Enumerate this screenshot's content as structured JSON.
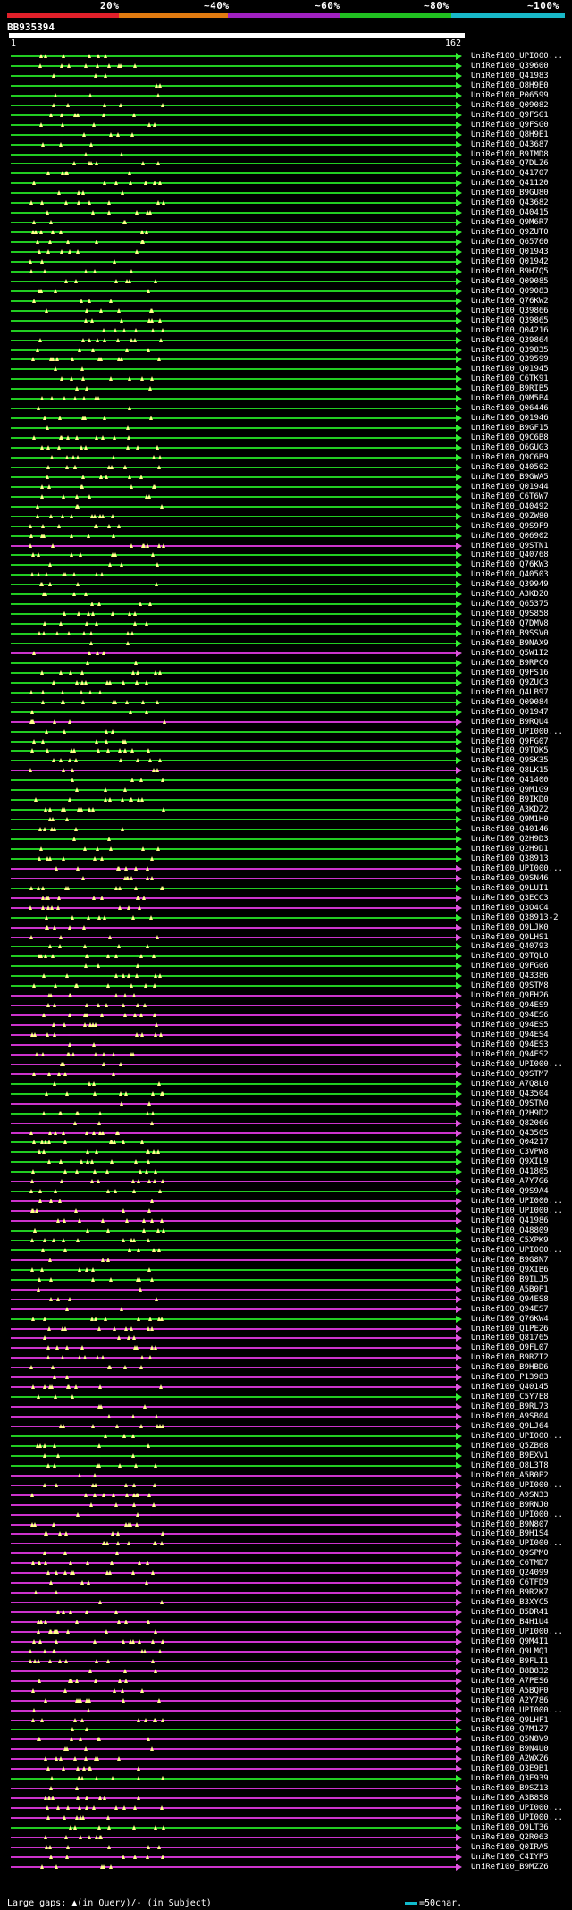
{
  "legend": {
    "labels": [
      "20%",
      "~40%",
      "~60%",
      "~80%",
      "~100%"
    ],
    "colors": [
      "#e0202a",
      "#e07a10",
      "#a020c0",
      "#20c020",
      "#18b8c8"
    ]
  },
  "query_id": "BB935394",
  "ruler": {
    "start": "1",
    "end": "162"
  },
  "colors": {
    "green": "#22cc22",
    "magenta": "#cc33cc",
    "gap": "#ffff88",
    "arrow": "#22dd22"
  },
  "footer": {
    "gaps_label": "Large gaps: ▲(in Query)/- (in Subject)",
    "scale_label": "=50char."
  },
  "hits": [
    {
      "name": "UniRef100_UPI000...",
      "color": "green",
      "end": 0.97
    },
    {
      "name": "UniRef100_Q39600",
      "color": "green",
      "end": 0.97
    },
    {
      "name": "UniRef100_Q41983",
      "color": "green",
      "end": 0.97
    },
    {
      "name": "UniRef100_Q8H9E0",
      "color": "green",
      "end": 0.97
    },
    {
      "name": "UniRef100_P06599",
      "color": "green",
      "end": 0.97
    },
    {
      "name": "UniRef100_Q09082",
      "color": "green",
      "end": 0.97
    },
    {
      "name": "UniRef100_Q9FSG1",
      "color": "green",
      "end": 0.97
    },
    {
      "name": "UniRef100_Q9FSG0",
      "color": "green",
      "end": 0.97
    },
    {
      "name": "UniRef100_Q8H9E1",
      "color": "green",
      "end": 0.97
    },
    {
      "name": "UniRef100_Q43687",
      "color": "green",
      "end": 0.97
    },
    {
      "name": "UniRef100_B9IMD8",
      "color": "green",
      "end": 0.97
    },
    {
      "name": "UniRef100_Q7DLZ6",
      "color": "green",
      "end": 0.97
    },
    {
      "name": "UniRef100_Q41707",
      "color": "green",
      "end": 0.97
    },
    {
      "name": "UniRef100_Q41120",
      "color": "green",
      "end": 0.97
    },
    {
      "name": "UniRef100_B9GU80",
      "color": "green",
      "end": 0.97
    },
    {
      "name": "UniRef100_Q43682",
      "color": "green",
      "end": 0.97
    },
    {
      "name": "UniRef100_Q40415",
      "color": "green",
      "end": 0.97
    },
    {
      "name": "UniRef100_Q9M6R7",
      "color": "green",
      "end": 0.97
    },
    {
      "name": "UniRef100_Q9ZUT0",
      "color": "green",
      "end": 0.97
    },
    {
      "name": "UniRef100_Q65760",
      "color": "green",
      "end": 0.97
    },
    {
      "name": "UniRef100_Q01943",
      "color": "green",
      "end": 0.97
    },
    {
      "name": "UniRef100_Q01942",
      "color": "green",
      "end": 0.97
    },
    {
      "name": "UniRef100_B9H7Q5",
      "color": "green",
      "end": 0.97
    },
    {
      "name": "UniRef100_Q09085",
      "color": "green",
      "end": 0.97
    },
    {
      "name": "UniRef100_Q09083",
      "color": "green",
      "end": 0.97
    },
    {
      "name": "UniRef100_Q76KW2",
      "color": "green",
      "end": 0.97
    },
    {
      "name": "UniRef100_Q39866",
      "color": "green",
      "end": 0.97
    },
    {
      "name": "UniRef100_Q39865",
      "color": "green",
      "end": 0.97
    },
    {
      "name": "UniRef100_Q04216",
      "color": "green",
      "end": 0.97
    },
    {
      "name": "UniRef100_Q39864",
      "color": "green",
      "end": 0.97
    },
    {
      "name": "UniRef100_Q39835",
      "color": "green",
      "end": 0.97
    },
    {
      "name": "UniRef100_Q39599",
      "color": "green",
      "end": 0.97
    },
    {
      "name": "UniRef100_Q01945",
      "color": "green",
      "end": 0.97
    },
    {
      "name": "UniRef100_C6TK91",
      "color": "green",
      "end": 0.97
    },
    {
      "name": "UniRef100_B9RIB5",
      "color": "green",
      "end": 0.97
    },
    {
      "name": "UniRef100_Q9M5B4",
      "color": "green",
      "end": 0.97
    },
    {
      "name": "UniRef100_Q06446",
      "color": "green",
      "end": 0.97
    },
    {
      "name": "UniRef100_Q01946",
      "color": "green",
      "end": 0.97
    },
    {
      "name": "UniRef100_B9GF15",
      "color": "green",
      "end": 0.97
    },
    {
      "name": "UniRef100_Q9C6B8",
      "color": "green",
      "end": 0.97
    },
    {
      "name": "UniRef100_Q6GUG3",
      "color": "green",
      "end": 0.97
    },
    {
      "name": "UniRef100_Q9C6B9",
      "color": "green",
      "end": 0.97
    },
    {
      "name": "UniRef100_Q40502",
      "color": "green",
      "end": 0.97
    },
    {
      "name": "UniRef100_B9GWA5",
      "color": "green",
      "end": 0.97
    },
    {
      "name": "UniRef100_Q01944",
      "color": "green",
      "end": 0.97
    },
    {
      "name": "UniRef100_C6T6W7",
      "color": "green",
      "end": 0.97
    },
    {
      "name": "UniRef100_Q40492",
      "color": "green",
      "end": 0.97
    },
    {
      "name": "UniRef100_Q9ZW80",
      "color": "green",
      "end": 0.97
    },
    {
      "name": "UniRef100_Q9S9F9",
      "color": "green",
      "end": 0.97
    },
    {
      "name": "UniRef100_Q06902",
      "color": "green",
      "end": 0.97
    },
    {
      "name": "UniRef100_Q9STN1",
      "color": "magenta",
      "end": 0.97
    },
    {
      "name": "UniRef100_Q40768",
      "color": "green",
      "end": 0.97
    },
    {
      "name": "UniRef100_Q76KW3",
      "color": "green",
      "end": 0.97
    },
    {
      "name": "UniRef100_Q40503",
      "color": "green",
      "end": 0.97
    },
    {
      "name": "UniRef100_Q39949",
      "color": "green",
      "end": 0.97
    },
    {
      "name": "UniRef100_A3KDZ0",
      "color": "green",
      "end": 0.97
    },
    {
      "name": "UniRef100_Q65375",
      "color": "green",
      "end": 0.97
    },
    {
      "name": "UniRef100_Q9S858",
      "color": "green",
      "end": 0.97
    },
    {
      "name": "UniRef100_Q7DMV8",
      "color": "green",
      "end": 0.97
    },
    {
      "name": "UniRef100_B9SSV0",
      "color": "green",
      "end": 0.97
    },
    {
      "name": "UniRef100_B9NAX9",
      "color": "green",
      "end": 0.97
    },
    {
      "name": "UniRef100_Q5W1I2",
      "color": "magenta",
      "end": 0.97
    },
    {
      "name": "UniRef100_B9RPC0",
      "color": "green",
      "end": 0.97
    },
    {
      "name": "UniRef100_Q9FS16",
      "color": "green",
      "end": 0.97
    },
    {
      "name": "UniRef100_Q9ZUC3",
      "color": "green",
      "end": 0.97
    },
    {
      "name": "UniRef100_Q4LB97",
      "color": "green",
      "end": 0.97
    },
    {
      "name": "UniRef100_Q09084",
      "color": "green",
      "end": 0.97
    },
    {
      "name": "UniRef100_Q01947",
      "color": "green",
      "end": 0.97
    },
    {
      "name": "UniRef100_B9RQU4",
      "color": "magenta",
      "end": 0.97
    },
    {
      "name": "UniRef100_UPI000...",
      "color": "green",
      "end": 0.97
    },
    {
      "name": "UniRef100_Q9FG07",
      "color": "green",
      "end": 0.97
    },
    {
      "name": "UniRef100_Q9TQK5",
      "color": "green",
      "end": 0.97
    },
    {
      "name": "UniRef100_Q9SK35",
      "color": "green",
      "end": 0.97
    },
    {
      "name": "UniRef100_Q8LK15",
      "color": "magenta",
      "end": 0.97
    },
    {
      "name": "UniRef100_Q41400",
      "color": "green",
      "end": 0.97
    },
    {
      "name": "UniRef100_Q9M1G9",
      "color": "green",
      "end": 0.97
    },
    {
      "name": "UniRef100_B9IKD0",
      "color": "green",
      "end": 0.97
    },
    {
      "name": "UniRef100_A3KDZ2",
      "color": "green",
      "end": 0.97
    },
    {
      "name": "UniRef100_Q9M1H0",
      "color": "green",
      "end": 0.97
    },
    {
      "name": "UniRef100_Q40146",
      "color": "green",
      "end": 0.97
    },
    {
      "name": "UniRef100_Q2H9D3",
      "color": "green",
      "end": 0.97
    },
    {
      "name": "UniRef100_Q2H9D1",
      "color": "green",
      "end": 0.97
    },
    {
      "name": "UniRef100_Q38913",
      "color": "green",
      "end": 0.97
    },
    {
      "name": "UniRef100_UPI000...",
      "color": "magenta",
      "end": 0.97
    },
    {
      "name": "UniRef100_Q9SN46",
      "color": "magenta",
      "end": 0.97
    },
    {
      "name": "UniRef100_Q9LUI1",
      "color": "green",
      "end": 0.97
    },
    {
      "name": "UniRef100_Q3ECC3",
      "color": "magenta",
      "end": 0.97
    },
    {
      "name": "UniRef100_Q3O4C4",
      "color": "magenta",
      "end": 0.97
    },
    {
      "name": "UniRef100_Q38913-2",
      "color": "green",
      "end": 0.97
    },
    {
      "name": "UniRef100_Q9LJK0",
      "color": "magenta",
      "end": 0.97
    },
    {
      "name": "UniRef100_Q9LHS1",
      "color": "magenta",
      "end": 0.97
    },
    {
      "name": "UniRef100_Q40793",
      "color": "green",
      "end": 0.97
    },
    {
      "name": "UniRef100_Q9TQL0",
      "color": "green",
      "end": 0.97
    },
    {
      "name": "UniRef100_Q9FG06",
      "color": "green",
      "end": 0.97
    },
    {
      "name": "UniRef100_Q43386",
      "color": "green",
      "end": 0.97
    },
    {
      "name": "UniRef100_Q9STM8",
      "color": "green",
      "end": 0.97
    },
    {
      "name": "UniRef100_Q9FH26",
      "color": "magenta",
      "end": 0.97
    },
    {
      "name": "UniRef100_Q94ES9",
      "color": "magenta",
      "end": 0.97
    },
    {
      "name": "UniRef100_Q94ES6",
      "color": "magenta",
      "end": 0.97
    },
    {
      "name": "UniRef100_Q94ES5",
      "color": "magenta",
      "end": 0.97
    },
    {
      "name": "UniRef100_Q94ES4",
      "color": "magenta",
      "end": 0.97
    },
    {
      "name": "UniRef100_Q94ES3",
      "color": "magenta",
      "end": 0.97
    },
    {
      "name": "UniRef100_Q94ES2",
      "color": "magenta",
      "end": 0.97
    },
    {
      "name": "UniRef100_UPI000...",
      "color": "magenta",
      "end": 0.97
    },
    {
      "name": "UniRef100_Q9STM7",
      "color": "magenta",
      "end": 0.97
    },
    {
      "name": "UniRef100_A7Q8L0",
      "color": "green",
      "end": 0.97
    },
    {
      "name": "UniRef100_Q43504",
      "color": "green",
      "end": 0.97
    },
    {
      "name": "UniRef100_Q9STN0",
      "color": "magenta",
      "end": 0.97
    },
    {
      "name": "UniRef100_Q2H9D2",
      "color": "green",
      "end": 0.97
    },
    {
      "name": "UniRef100_Q82066",
      "color": "magenta",
      "end": 0.97
    },
    {
      "name": "UniRef100_Q43505",
      "color": "magenta",
      "end": 0.97
    },
    {
      "name": "UniRef100_Q04217",
      "color": "green",
      "end": 0.97
    },
    {
      "name": "UniRef100_C3VPW8",
      "color": "green",
      "end": 0.97
    },
    {
      "name": "UniRef100_Q9XIL9",
      "color": "green",
      "end": 0.97
    },
    {
      "name": "UniRef100_Q41805",
      "color": "green",
      "end": 0.97
    },
    {
      "name": "UniRef100_A7Y7G6",
      "color": "magenta",
      "end": 0.97
    },
    {
      "name": "UniRef100_Q9S9A4",
      "color": "green",
      "end": 0.97
    },
    {
      "name": "UniRef100_UPI000...",
      "color": "magenta",
      "end": 0.97
    },
    {
      "name": "UniRef100_UPI000...",
      "color": "magenta",
      "end": 0.97
    },
    {
      "name": "UniRef100_Q41986",
      "color": "magenta",
      "end": 0.97
    },
    {
      "name": "UniRef100_Q48809",
      "color": "green",
      "end": 0.97
    },
    {
      "name": "UniRef100_C5XPK9",
      "color": "green",
      "end": 0.97
    },
    {
      "name": "UniRef100_UPI000...",
      "color": "green",
      "end": 0.97
    },
    {
      "name": "UniRef100_B9G8N7",
      "color": "magenta",
      "end": 0.97
    },
    {
      "name": "UniRef100_Q9XIB6",
      "color": "green",
      "end": 0.97
    },
    {
      "name": "UniRef100_B9ILJ5",
      "color": "green",
      "end": 0.97
    },
    {
      "name": "UniRef100_A5B0P1",
      "color": "magenta",
      "end": 0.97
    },
    {
      "name": "UniRef100_Q94ES8",
      "color": "magenta",
      "end": 0.97
    },
    {
      "name": "UniRef100_Q94ES7",
      "color": "magenta",
      "end": 0.97
    },
    {
      "name": "UniRef100_Q76KW4",
      "color": "green",
      "end": 0.97
    },
    {
      "name": "UniRef100_Q1PE26",
      "color": "magenta",
      "end": 0.97
    },
    {
      "name": "UniRef100_Q81765",
      "color": "magenta",
      "end": 0.97
    },
    {
      "name": "UniRef100_Q9FL07",
      "color": "magenta",
      "end": 0.97
    },
    {
      "name": "UniRef100_B9RZI2",
      "color": "magenta",
      "end": 0.97
    },
    {
      "name": "UniRef100_B9HBD6",
      "color": "magenta",
      "end": 0.97
    },
    {
      "name": "UniRef100_P13983",
      "color": "magenta",
      "end": 0.97
    },
    {
      "name": "UniRef100_Q40145",
      "color": "magenta",
      "end": 0.97
    },
    {
      "name": "UniRef100_C5Y7E8",
      "color": "green",
      "end": 0.97
    },
    {
      "name": "UniRef100_B9RL73",
      "color": "magenta",
      "end": 0.97
    },
    {
      "name": "UniRef100_A9SB04",
      "color": "magenta",
      "end": 0.97
    },
    {
      "name": "UniRef100_Q9LJ64",
      "color": "magenta",
      "end": 0.97
    },
    {
      "name": "UniRef100_UPI000...",
      "color": "green",
      "end": 0.97
    },
    {
      "name": "UniRef100_Q5ZB68",
      "color": "green",
      "end": 0.97
    },
    {
      "name": "UniRef100_B9EXV1",
      "color": "green",
      "end": 0.97
    },
    {
      "name": "UniRef100_Q8L3T8",
      "color": "green",
      "end": 0.97
    },
    {
      "name": "UniRef100_A5B0P2",
      "color": "magenta",
      "end": 0.97
    },
    {
      "name": "UniRef100_UPI000...",
      "color": "magenta",
      "end": 0.97
    },
    {
      "name": "UniRef100_A9SN33",
      "color": "magenta",
      "end": 0.97
    },
    {
      "name": "UniRef100_B9RNJ0",
      "color": "magenta",
      "end": 0.97
    },
    {
      "name": "UniRef100_UPI000...",
      "color": "magenta",
      "end": 0.97
    },
    {
      "name": "UniRef100_B9N807",
      "color": "magenta",
      "end": 0.97
    },
    {
      "name": "UniRef100_B9H1S4",
      "color": "magenta",
      "end": 0.97
    },
    {
      "name": "UniRef100_UPI000...",
      "color": "magenta",
      "end": 0.97
    },
    {
      "name": "UniRef100_Q9SPM0",
      "color": "magenta",
      "end": 0.97
    },
    {
      "name": "UniRef100_C6TMD7",
      "color": "magenta",
      "end": 0.97
    },
    {
      "name": "UniRef100_Q24099",
      "color": "magenta",
      "end": 0.97
    },
    {
      "name": "UniRef100_C6TFD9",
      "color": "magenta",
      "end": 0.97
    },
    {
      "name": "UniRef100_B9R2K7",
      "color": "magenta",
      "end": 0.97
    },
    {
      "name": "UniRef100_B3XYC5",
      "color": "magenta",
      "end": 0.97
    },
    {
      "name": "UniRef100_B5DR41",
      "color": "magenta",
      "end": 0.97
    },
    {
      "name": "UniRef100_B4H1U4",
      "color": "magenta",
      "end": 0.97
    },
    {
      "name": "UniRef100_UPI000...",
      "color": "magenta",
      "end": 0.97
    },
    {
      "name": "UniRef100_Q9M4I1",
      "color": "magenta",
      "end": 0.97
    },
    {
      "name": "UniRef100_Q9LMQ1",
      "color": "magenta",
      "end": 0.97
    },
    {
      "name": "UniRef100_B9FLI1",
      "color": "magenta",
      "end": 0.97
    },
    {
      "name": "UniRef100_B8B832",
      "color": "magenta",
      "end": 0.97
    },
    {
      "name": "UniRef100_A7PES6",
      "color": "magenta",
      "end": 0.97
    },
    {
      "name": "UniRef100_A5BQP0",
      "color": "magenta",
      "end": 0.97
    },
    {
      "name": "UniRef100_A2Y786",
      "color": "magenta",
      "end": 0.97
    },
    {
      "name": "UniRef100_UPI000...",
      "color": "magenta",
      "end": 0.97
    },
    {
      "name": "UniRef100_Q9LHF1",
      "color": "magenta",
      "end": 0.97
    },
    {
      "name": "UniRef100_Q7M1Z7",
      "color": "green",
      "end": 0.97
    },
    {
      "name": "UniRef100_Q5N8V9",
      "color": "magenta",
      "end": 0.97
    },
    {
      "name": "UniRef100_B9N4U0",
      "color": "magenta",
      "end": 0.97
    },
    {
      "name": "UniRef100_A2WXZ6",
      "color": "magenta",
      "end": 0.97
    },
    {
      "name": "UniRef100_Q3E9B1",
      "color": "magenta",
      "end": 0.97
    },
    {
      "name": "UniRef100_Q3E939",
      "color": "green",
      "end": 0.97
    },
    {
      "name": "UniRef100_B9SZ13",
      "color": "magenta",
      "end": 0.97
    },
    {
      "name": "UniRef100_A3B8S8",
      "color": "magenta",
      "end": 0.97
    },
    {
      "name": "UniRef100_UPI000...",
      "color": "magenta",
      "end": 0.97
    },
    {
      "name": "UniRef100_UPI000...",
      "color": "magenta",
      "end": 0.97
    },
    {
      "name": "UniRef100_Q9LT36",
      "color": "green",
      "end": 0.97
    },
    {
      "name": "UniRef100_Q2R063",
      "color": "magenta",
      "end": 0.97
    },
    {
      "name": "UniRef100_Q0IRA5",
      "color": "magenta",
      "end": 0.97
    },
    {
      "name": "UniRef100_C4IYP5",
      "color": "magenta",
      "end": 0.97
    },
    {
      "name": "UniRef100_B9MZZ6",
      "color": "magenta",
      "end": 0.97
    }
  ]
}
